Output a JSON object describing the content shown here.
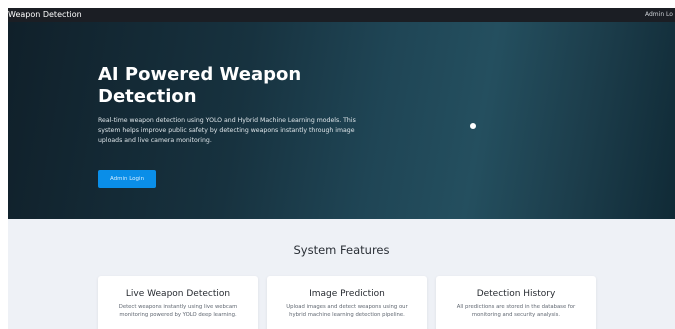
{
  "navbar": {
    "brand": "Weapon Detection",
    "admin_link": "Admin Lo"
  },
  "hero": {
    "title": "AI Powered Weapon Detection",
    "description": "Real-time weapon detection using YOLO and Hybrid Machine Learning models. This system helps improve public safety by detecting weapons instantly through image uploads and live camera monitoring.",
    "button_label": "Admin Login"
  },
  "features": {
    "title": "System Features",
    "cards": [
      {
        "title": "Live Weapon Detection",
        "description": "Detect weapons instantly using live webcam monitoring powered by YOLO deep learning."
      },
      {
        "title": "Image Prediction",
        "description": "Upload images and detect weapons using our hybrid machine learning detection pipeline."
      },
      {
        "title": "Detection History",
        "description": "All predictions are stored in the database for monitoring and security analysis."
      }
    ]
  },
  "colors": {
    "navbar": "#1b1e24",
    "accent": "#0a8ee8",
    "features_bg": "#eef1f6"
  }
}
